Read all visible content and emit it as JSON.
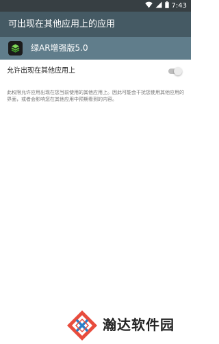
{
  "status_bar": {
    "time": "7:43",
    "icons": [
      "wifi-icon",
      "signal-icon",
      "battery-icon"
    ]
  },
  "app_bar": {
    "title": "可出现在其他应用上的应用"
  },
  "app_header": {
    "app_name": "绿AR增强版5.0",
    "icon": "app-logo-icon"
  },
  "setting": {
    "label": "允许出现在其他应用上",
    "enabled": false
  },
  "description": "此权限允许应用出现在您当前使用的其他应用上。因此可能会干扰您使用其他应用的界面，或者会影响您在其他应用中预期看到的内容。",
  "watermark": {
    "text": "瀚达软件园"
  },
  "colors": {
    "status_bar": "#373f43",
    "app_bar": "#455a64",
    "app_header": "#607d8b",
    "toggle_off_track": "#bdbdbd",
    "toggle_off_thumb": "#ececec"
  }
}
